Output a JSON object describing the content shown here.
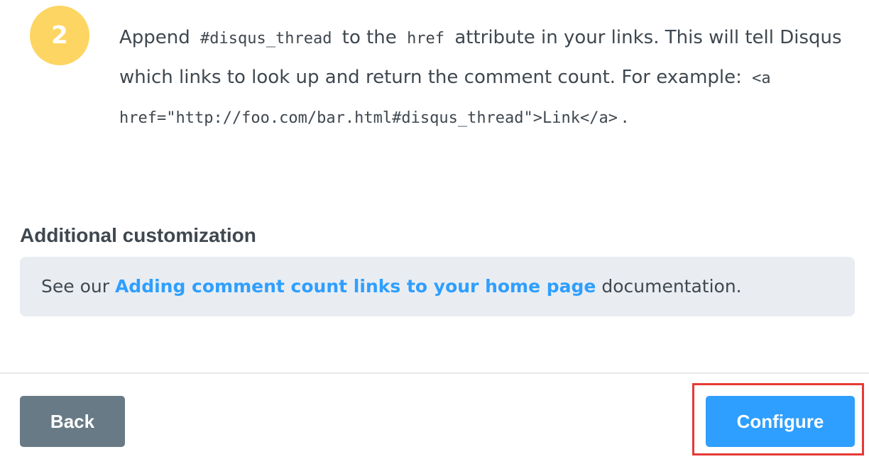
{
  "step": {
    "number": "2",
    "text_before_code1": "Append",
    "code1": "#disqus_thread",
    "text_between": "to the",
    "code2": "href",
    "text_after_code2": "attribute in your links. This will tell Disqus which links to look up and return the comment count. For example:",
    "code_example": "<a href=\"http://foo.com/bar.html#disqus_thread\">Link</a>",
    "trailing": "."
  },
  "customization": {
    "title": "Additional customization",
    "prefix": "See our",
    "link_label": "Adding comment count links to your home page",
    "suffix": "documentation."
  },
  "footer": {
    "back_label": "Back",
    "configure_label": "Configure"
  },
  "colors": {
    "badge": "#fdd563",
    "link": "#2e9fff",
    "back_button": "#687a86",
    "configure_button": "#2e9fff",
    "highlight": "#e53935"
  }
}
